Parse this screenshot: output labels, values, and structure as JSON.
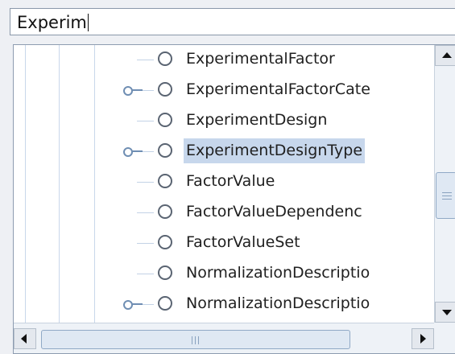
{
  "search": {
    "value": "Experim"
  },
  "tree": {
    "items": [
      {
        "label": "ExperimentalFactor",
        "expandable": false,
        "selected": false
      },
      {
        "label": "ExperimentalFactorCate",
        "expandable": true,
        "selected": false
      },
      {
        "label": "ExperimentDesign",
        "expandable": false,
        "selected": false
      },
      {
        "label": "ExperimentDesignType",
        "expandable": true,
        "selected": true
      },
      {
        "label": "FactorValue",
        "expandable": false,
        "selected": false
      },
      {
        "label": "FactorValueDependenc",
        "expandable": false,
        "selected": false
      },
      {
        "label": "FactorValueSet",
        "expandable": false,
        "selected": false
      },
      {
        "label": "NormalizationDescriptio",
        "expandable": false,
        "selected": false
      },
      {
        "label": "NormalizationDescriptio",
        "expandable": true,
        "selected": false
      }
    ]
  },
  "icons": {
    "node": "circle-icon",
    "expander": "expander-handle-icon",
    "scroll_up": "arrow-up-icon",
    "scroll_down": "arrow-down-icon",
    "scroll_left": "arrow-left-icon",
    "scroll_right": "arrow-right-icon"
  },
  "colors": {
    "selection": "#c7d7ec",
    "guide_lines": "#c8d7ea",
    "expander": "#6f8eb3"
  }
}
